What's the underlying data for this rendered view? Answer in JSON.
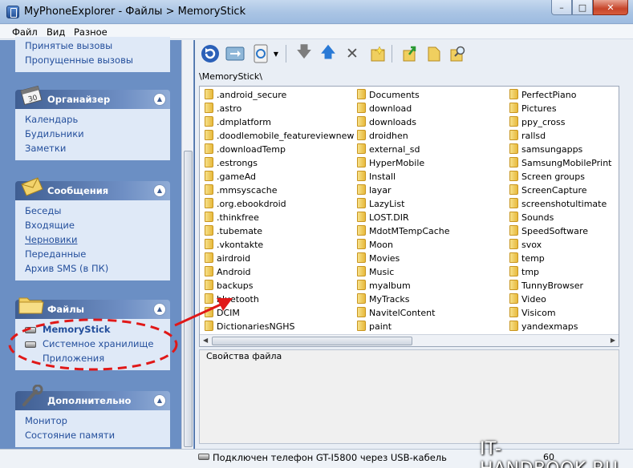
{
  "window": {
    "title": "MyPhoneExplorer - Файлы > MemoryStick",
    "controls": {
      "minimize": "–",
      "maximize": "□",
      "close": "✕"
    }
  },
  "menu": [
    "Файл",
    "Вид",
    "Разное"
  ],
  "sidebar": {
    "calls_partial": {
      "items": [
        "Принятые вызовы",
        "Пропущенные вызовы"
      ]
    },
    "organizer": {
      "title": "Органайзер",
      "icon": "calendar-icon",
      "items": [
        "Календарь",
        "Будильники",
        "Заметки"
      ]
    },
    "messages": {
      "title": "Сообщения",
      "icon": "envelope-icon",
      "items": [
        "Беседы",
        "Входящие",
        "Черновики",
        "Переданные",
        "Архив SMS (в ПК)"
      ]
    },
    "files": {
      "title": "Файлы",
      "icon": "folder-icon",
      "items": [
        "MemoryStick",
        "Системное хранилище",
        "Приложения"
      ]
    },
    "extra": {
      "title": "Дополнительно",
      "icon": "wrench-icon",
      "items": [
        "Монитор",
        "Состояние памяти"
      ]
    }
  },
  "toolbar": {
    "buttons": [
      "refresh-icon",
      "sync-icon",
      "phone-sync-icon",
      "dropdown-arrow-icon",
      "download-icon",
      "upload-icon",
      "delete-icon",
      "new-folder-icon",
      "open-icon",
      "folder-icon",
      "search-icon"
    ]
  },
  "path": "\\MemoryStick\\",
  "files": {
    "col1": [
      ".android_secure",
      ".astro",
      ".dmplatform",
      ".doodlemobile_featureviewnew",
      ".downloadTemp",
      ".estrongs",
      ".gameAd",
      ".mmsyscache",
      ".org.ebookdroid",
      ".thinkfree",
      ".tubemate",
      ".vkontakte",
      "airdroid",
      "Android",
      "backups",
      "bluetooth",
      "DCIM",
      "DictionariesNGHS"
    ],
    "col2": [
      "Documents",
      "download",
      "downloads",
      "droidhen",
      "external_sd",
      "HyperMobile",
      "Install",
      "layar",
      "LazyList",
      "LOST.DIR",
      "MdotMTempCache",
      "Moon",
      "Movies",
      "Music",
      "myalbum",
      "MyTracks",
      "NavitelContent",
      "paint"
    ],
    "col3": [
      "PerfectPiano",
      "Pictures",
      "ppy_cross",
      "rallsd",
      "samsungapps",
      "SamsungMobilePrint",
      "Screen groups",
      "ScreenCapture",
      "screenshotultimate",
      "Sounds",
      "SpeedSoftware",
      "svox",
      "temp",
      "tmp",
      "TunnyBrowser",
      "Video",
      "Visicom",
      "yandexmaps"
    ]
  },
  "properties": {
    "title": "Свойства файла"
  },
  "status": {
    "text": "Подключен телефон GT-I5800 через USB-кабель",
    "number": "60"
  },
  "watermark": "IT-HANDBOOK.RU",
  "colors": {
    "accent": "#244f9c",
    "panel": "#6b8fc4",
    "annotation": "#e01818"
  }
}
